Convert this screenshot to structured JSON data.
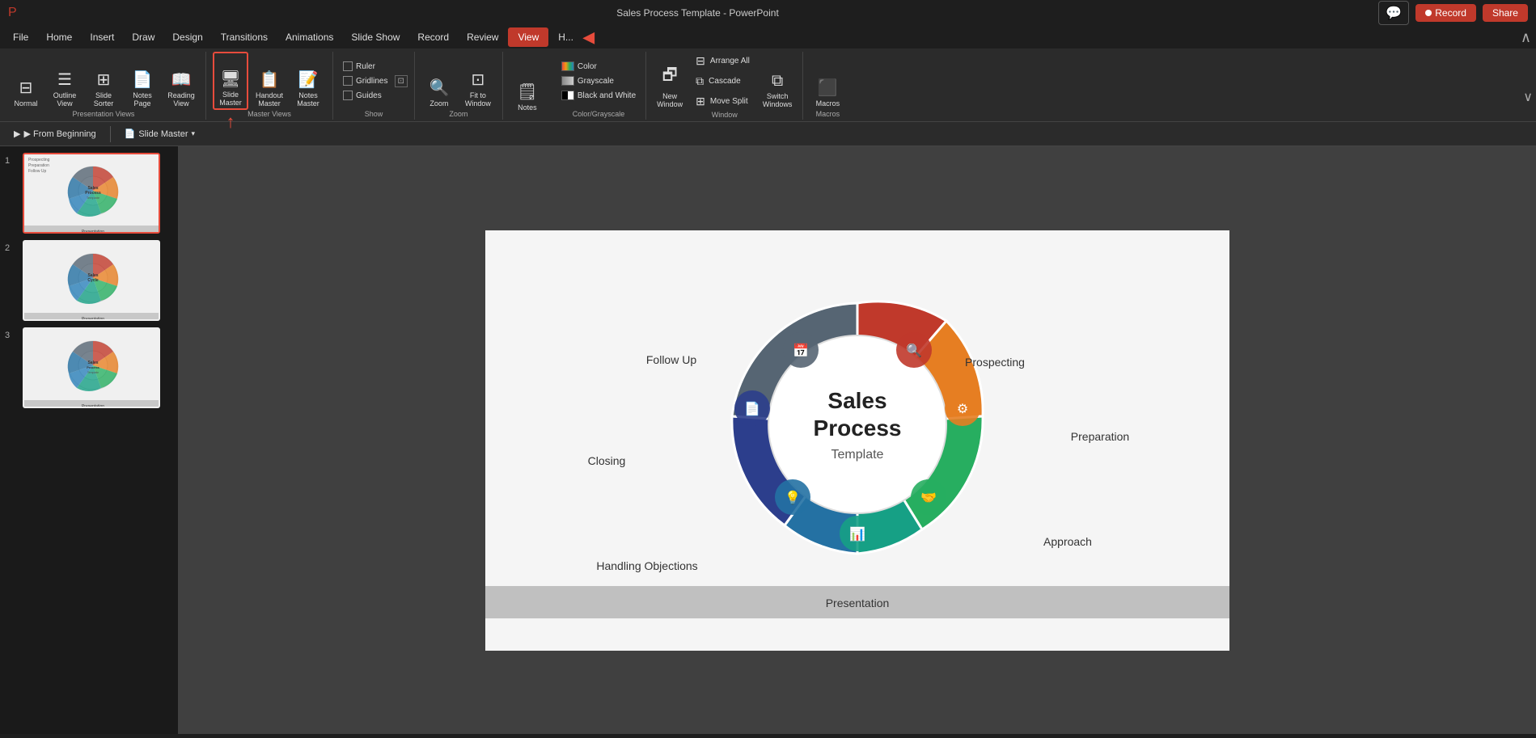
{
  "titlebar": {
    "record_label": "Record",
    "share_label": "Share",
    "comments_icon": "💬"
  },
  "menubar": {
    "items": [
      "File",
      "Home",
      "Insert",
      "Draw",
      "Design",
      "Transitions",
      "Animations",
      "Slide Show",
      "Record",
      "Review",
      "View",
      "H..."
    ],
    "active": "View",
    "arrow_char": "◀"
  },
  "ribbon": {
    "presentation_views": {
      "label": "Presentation Views",
      "buttons": [
        {
          "id": "normal",
          "label": "Normal",
          "icon": "▦"
        },
        {
          "id": "outline",
          "label": "Outline\nView",
          "icon": "☰"
        },
        {
          "id": "slide-sorter",
          "label": "Slide\nSorter",
          "icon": "⊞"
        },
        {
          "id": "notes-page",
          "label": "Notes\nPage",
          "icon": "📄"
        },
        {
          "id": "reading-view",
          "label": "Reading\nView",
          "icon": "📖"
        }
      ]
    },
    "master_views": {
      "label": "Master Views",
      "buttons": [
        {
          "id": "slide-master",
          "label": "Slide\nMaster",
          "icon": "🖥",
          "highlighted": true
        },
        {
          "id": "handout-master",
          "label": "Handout\nMaster",
          "icon": "📋"
        },
        {
          "id": "notes-master",
          "label": "Notes\nMaster",
          "icon": "📝"
        }
      ]
    },
    "show": {
      "label": "Show",
      "checkboxes": [
        "Ruler",
        "Gridlines",
        "Guides"
      ]
    },
    "zoom": {
      "label": "Zoom",
      "buttons": [
        {
          "id": "zoom",
          "label": "Zoom",
          "icon": "🔍"
        },
        {
          "id": "fit-to-window",
          "label": "Fit to\nWindow",
          "icon": "⊡"
        }
      ]
    },
    "color_grayscale": {
      "label": "Color/Grayscale",
      "options": [
        {
          "id": "color",
          "label": "Color",
          "color": "#4472c4"
        },
        {
          "id": "grayscale",
          "label": "Grayscale",
          "color": "#888"
        },
        {
          "id": "black-white",
          "label": "Black and White",
          "color": "#000"
        }
      ]
    },
    "window": {
      "label": "Window",
      "buttons": [
        {
          "id": "new-window",
          "label": "New\nWindow",
          "icon": "🗗"
        },
        {
          "id": "arrange-all",
          "label": "Arrange All",
          "small": true
        },
        {
          "id": "cascade",
          "label": "Cascade",
          "small": true
        },
        {
          "id": "move-split",
          "label": "Move Split",
          "small": true
        },
        {
          "id": "switch-windows",
          "label": "Switch\nWindows",
          "icon": "⧉"
        }
      ]
    },
    "macros": {
      "label": "Macros",
      "icon": "⬛",
      "label_text": "Macros"
    }
  },
  "toolbar2": {
    "from_beginning": "▶ From Beginning",
    "slide_master": "📄 Slide Master",
    "dropdown": "▾"
  },
  "slides": [
    {
      "number": "1",
      "selected": true
    },
    {
      "number": "2",
      "selected": false
    },
    {
      "number": "3",
      "selected": false
    }
  ],
  "slide_main": {
    "title": "Sales\nProcess",
    "subtitle": "Template",
    "segments": [
      {
        "label": "Prospecting",
        "color": "#c0392b",
        "angle": 40
      },
      {
        "label": "Preparation",
        "color": "#e67e22",
        "angle": 100
      },
      {
        "label": "Approach",
        "color": "#27ae60",
        "angle": 160
      },
      {
        "label": "Presentation",
        "color": "#16a085",
        "angle": 210
      },
      {
        "label": "Handling Objections",
        "color": "#2980b9",
        "angle": 255
      },
      {
        "label": "Closing",
        "color": "#2471a3",
        "angle": 300
      },
      {
        "label": "Follow Up",
        "color": "#566573",
        "angle": 345
      }
    ],
    "bottom_label": "Presentation"
  },
  "notes_label": "Notes",
  "status": {
    "zoom": "Notes"
  }
}
